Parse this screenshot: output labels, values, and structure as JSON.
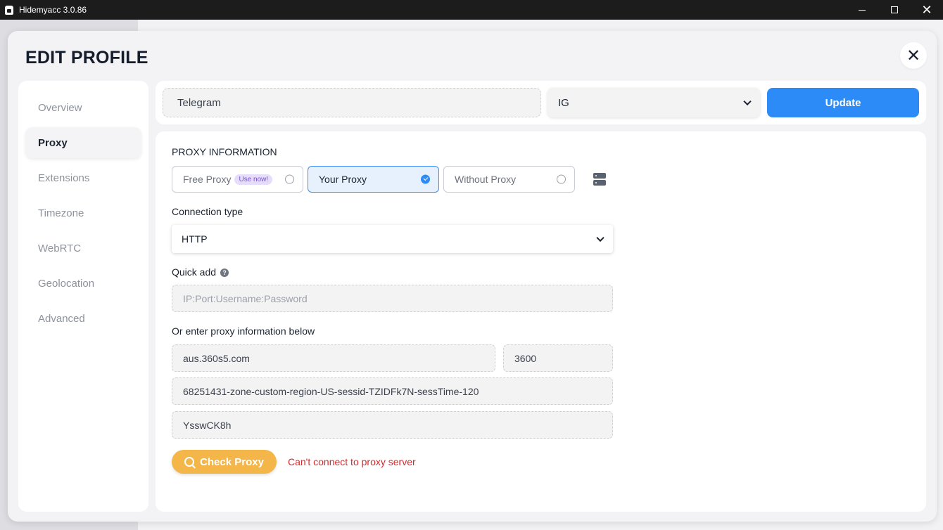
{
  "window": {
    "title": "Hidemyacc 3.0.86"
  },
  "modal": {
    "title": "EDIT PROFILE",
    "close_label": "✕"
  },
  "sidebar": {
    "items": [
      {
        "label": "Overview",
        "active": false
      },
      {
        "label": "Proxy",
        "active": true
      },
      {
        "label": "Extensions",
        "active": false
      },
      {
        "label": "Timezone",
        "active": false
      },
      {
        "label": "WebRTC",
        "active": false
      },
      {
        "label": "Geolocation",
        "active": false
      },
      {
        "label": "Advanced",
        "active": false
      }
    ]
  },
  "topbar": {
    "profile_name": "Telegram",
    "group": "IG",
    "update_label": "Update"
  },
  "proxy": {
    "section_title": "PROXY INFORMATION",
    "options": {
      "free": {
        "label": "Free Proxy",
        "badge": "Use now!"
      },
      "yours": {
        "label": "Your Proxy",
        "selected": true
      },
      "none": {
        "label": "Without Proxy"
      }
    },
    "connection_type_label": "Connection type",
    "connection_type": "HTTP",
    "quick_add_label": "Quick add",
    "quick_add_placeholder": "IP:Port:Username:Password",
    "manual_label": "Or enter proxy information below",
    "host": "aus.360s5.com",
    "port": "3600",
    "username": "68251431-zone-custom-region-US-sessid-TZIDFk7N-sessTime-120",
    "password": "YsswCK8h",
    "check_label": "Check Proxy",
    "error": "Can't connect to proxy server"
  },
  "icons": {
    "help": "?",
    "close": "✕"
  },
  "colors": {
    "primary": "#2d8bf8",
    "check_button": "#f4b648",
    "error": "#d8282a",
    "badge_bg": "#e6dcfb",
    "badge_text": "#7b52d6"
  }
}
